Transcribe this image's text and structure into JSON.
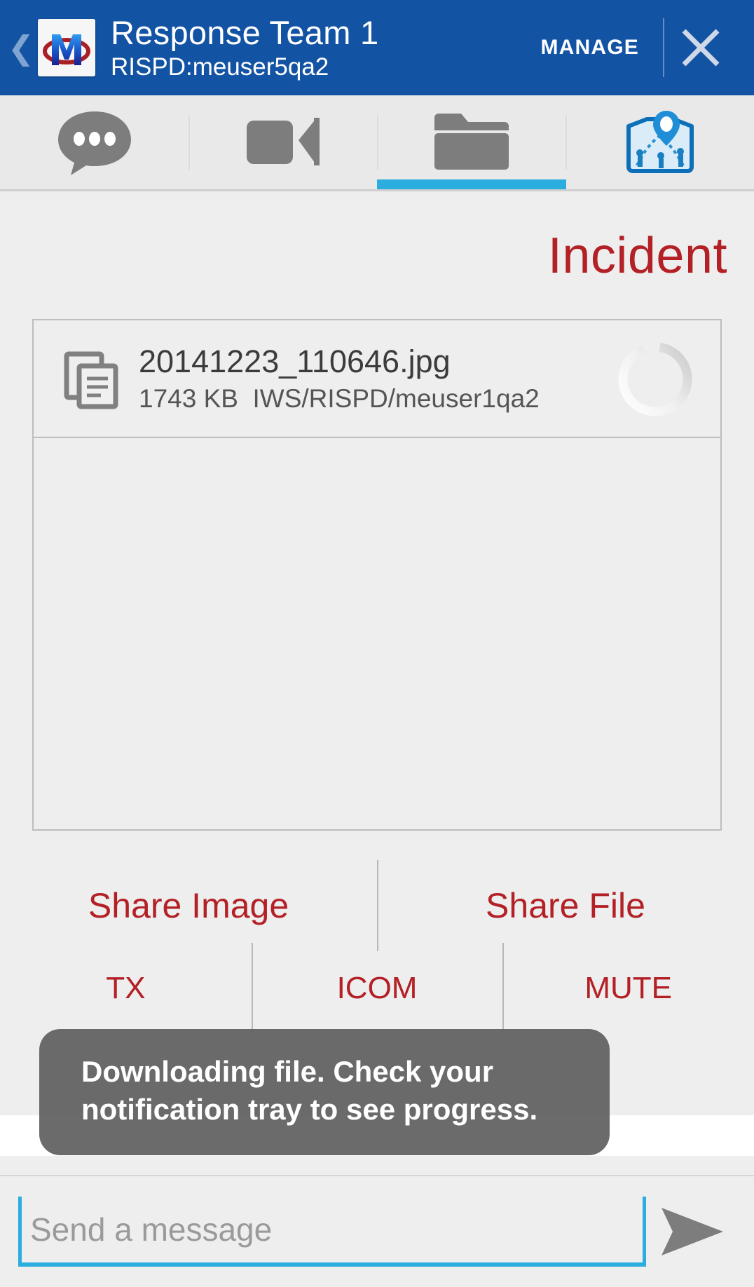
{
  "header": {
    "back_icon": "back-chevron-icon",
    "logo_icon": "app-logo-m-icon",
    "title": "Response Team 1",
    "subtitle": "RISPD:meuser5qa2",
    "manage_label": "MANAGE",
    "close_icon": "close-x-icon",
    "background_color": "#1353a4"
  },
  "tabs": [
    {
      "name": "chat",
      "icon": "chat-bubble-icon",
      "selected": false
    },
    {
      "name": "video",
      "icon": "video-camera-icon",
      "selected": false
    },
    {
      "name": "files",
      "icon": "folder-icon",
      "selected": true
    },
    {
      "name": "map",
      "icon": "map-pin-icon",
      "selected": false
    }
  ],
  "tab_indicator_color": "#2bade0",
  "main": {
    "section_title": "Incident",
    "section_title_color": "#b32025",
    "file": {
      "icon": "document-copy-icon",
      "name": "20141223_110646.jpg",
      "size": "1743 KB",
      "path": "IWS/RISPD/meuser1qa2",
      "status_icon": "loading-spinner-icon"
    }
  },
  "actions": {
    "row1": [
      {
        "label": "Share Image",
        "name": "share-image-button"
      },
      {
        "label": "Share File",
        "name": "share-file-button"
      }
    ],
    "row2": [
      {
        "label": "TX",
        "name": "tx-button"
      },
      {
        "label": "ICOM",
        "name": "icom-button"
      },
      {
        "label": "MUTE",
        "name": "mute-button"
      }
    ]
  },
  "toast": {
    "message": "Downloading file. Check your notification tray to see progress."
  },
  "message_bar": {
    "placeholder": "Send a message",
    "value": "",
    "send_icon": "send-arrow-icon",
    "accent_color": "#2bade0"
  }
}
